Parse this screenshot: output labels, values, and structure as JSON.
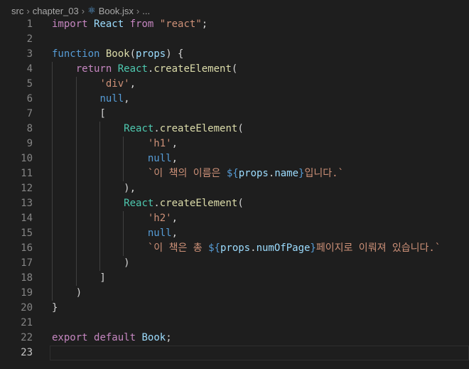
{
  "breadcrumb": {
    "items": [
      "src",
      "chapter_03",
      "Book.jsx",
      "..."
    ]
  },
  "active_line": 23,
  "lines": [
    [
      [
        "import",
        "kw"
      ],
      [
        " ",
        "p"
      ],
      [
        "React",
        "var"
      ],
      [
        " ",
        "p"
      ],
      [
        "from",
        "kw"
      ],
      [
        " ",
        "p"
      ],
      [
        "\"react\"",
        "str"
      ],
      [
        ";",
        "p"
      ]
    ],
    [],
    [
      [
        "function",
        "st"
      ],
      [
        " ",
        "p"
      ],
      [
        "Book",
        "fn"
      ],
      [
        "(",
        "p"
      ],
      [
        "props",
        "var"
      ],
      [
        ") {",
        "p"
      ]
    ],
    [
      [
        "    ",
        "p"
      ],
      [
        "return",
        "kw"
      ],
      [
        " ",
        "p"
      ],
      [
        "React",
        "cls"
      ],
      [
        ".",
        "p"
      ],
      [
        "createElement",
        "fn"
      ],
      [
        "(",
        "p"
      ]
    ],
    [
      [
        "        ",
        "p"
      ],
      [
        "'div'",
        "str"
      ],
      [
        ",",
        "p"
      ]
    ],
    [
      [
        "        ",
        "p"
      ],
      [
        "null",
        "st"
      ],
      [
        ",",
        "p"
      ]
    ],
    [
      [
        "        [",
        "p"
      ]
    ],
    [
      [
        "            ",
        "p"
      ],
      [
        "React",
        "cls"
      ],
      [
        ".",
        "p"
      ],
      [
        "createElement",
        "fn"
      ],
      [
        "(",
        "p"
      ]
    ],
    [
      [
        "                ",
        "p"
      ],
      [
        "'h1'",
        "str"
      ],
      [
        ",",
        "p"
      ]
    ],
    [
      [
        "                ",
        "p"
      ],
      [
        "null",
        "st"
      ],
      [
        ",",
        "p"
      ]
    ],
    [
      [
        "                ",
        "p"
      ],
      [
        "`이 책의 이름은 ",
        "str"
      ],
      [
        "${",
        "tb"
      ],
      [
        "props",
        "var"
      ],
      [
        ".",
        "p"
      ],
      [
        "name",
        "var"
      ],
      [
        "}",
        "tb"
      ],
      [
        "입니다.`",
        "str"
      ]
    ],
    [
      [
        "            ),",
        "p"
      ]
    ],
    [
      [
        "            ",
        "p"
      ],
      [
        "React",
        "cls"
      ],
      [
        ".",
        "p"
      ],
      [
        "createElement",
        "fn"
      ],
      [
        "(",
        "p"
      ]
    ],
    [
      [
        "                ",
        "p"
      ],
      [
        "'h2'",
        "str"
      ],
      [
        ",",
        "p"
      ]
    ],
    [
      [
        "                ",
        "p"
      ],
      [
        "null",
        "st"
      ],
      [
        ",",
        "p"
      ]
    ],
    [
      [
        "                ",
        "p"
      ],
      [
        "`이 책은 총 ",
        "str"
      ],
      [
        "${",
        "tb"
      ],
      [
        "props",
        "var"
      ],
      [
        ".",
        "p"
      ],
      [
        "numOfPage",
        "var"
      ],
      [
        "}",
        "tb"
      ],
      [
        "페이지로 이뤄져 있습니다.`",
        "str"
      ]
    ],
    [
      [
        "            )",
        "p"
      ]
    ],
    [
      [
        "        ]",
        "p"
      ]
    ],
    [
      [
        "    )",
        "p"
      ]
    ],
    [
      [
        "}",
        "p"
      ]
    ],
    [],
    [
      [
        "export",
        "kw"
      ],
      [
        " ",
        "p"
      ],
      [
        "default",
        "kw"
      ],
      [
        " ",
        "p"
      ],
      [
        "Book",
        "var"
      ],
      [
        ";",
        "p"
      ]
    ],
    []
  ]
}
